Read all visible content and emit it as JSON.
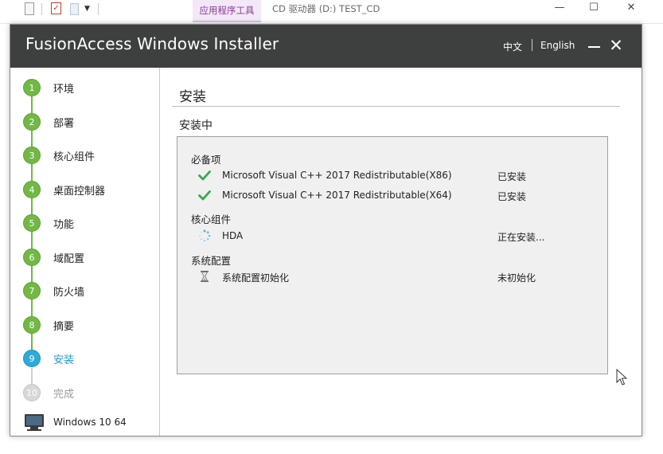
{
  "background_window": {
    "ribbon_context_tab": "应用程序工具",
    "title": "CD 驱动器 (D:) TEST_CD",
    "controls": {
      "minimize": "—",
      "maximize": "☐",
      "close": "✕"
    }
  },
  "installer": {
    "title": "FusionAccess Windows Installer",
    "languages": [
      "中文",
      "English"
    ],
    "controls": {
      "minimize": "—",
      "close": "✕"
    },
    "steps": [
      {
        "num": "1",
        "label": "环境",
        "state": "done"
      },
      {
        "num": "2",
        "label": "部署",
        "state": "done"
      },
      {
        "num": "3",
        "label": "核心组件",
        "state": "done"
      },
      {
        "num": "4",
        "label": "桌面控制器",
        "state": "done"
      },
      {
        "num": "5",
        "label": "功能",
        "state": "done"
      },
      {
        "num": "6",
        "label": "域配置",
        "state": "done"
      },
      {
        "num": "7",
        "label": "防火墙",
        "state": "done"
      },
      {
        "num": "8",
        "label": "摘要",
        "state": "done"
      },
      {
        "num": "9",
        "label": "安装",
        "state": "active"
      },
      {
        "num": "10",
        "label": "完成",
        "state": "pending"
      }
    ],
    "os_label": "Windows 10 64",
    "main": {
      "section_title": "安装",
      "status_title": "安装中",
      "groups": [
        {
          "title": "必备项",
          "items": [
            {
              "icon": "check-icon",
              "name": "Microsoft Visual C++ 2017 Redistributable(X86)",
              "status": "已安装"
            },
            {
              "icon": "check-icon",
              "name": "Microsoft Visual C++ 2017 Redistributable(X64)",
              "status": "已安装"
            }
          ]
        },
        {
          "title": "核心组件",
          "items": [
            {
              "icon": "spinner-icon",
              "name": "HDA",
              "status": "正在安装..."
            }
          ]
        },
        {
          "title": "系统配置",
          "items": [
            {
              "icon": "hourglass-icon",
              "name": "系统配置初始化",
              "status": "未初始化"
            }
          ]
        }
      ]
    }
  },
  "colors": {
    "titlebar": "#3e3f3f",
    "step_done": "#72b844",
    "step_active": "#2eaad9",
    "step_pending": "#d8d8d8",
    "check": "#3aa84a"
  }
}
